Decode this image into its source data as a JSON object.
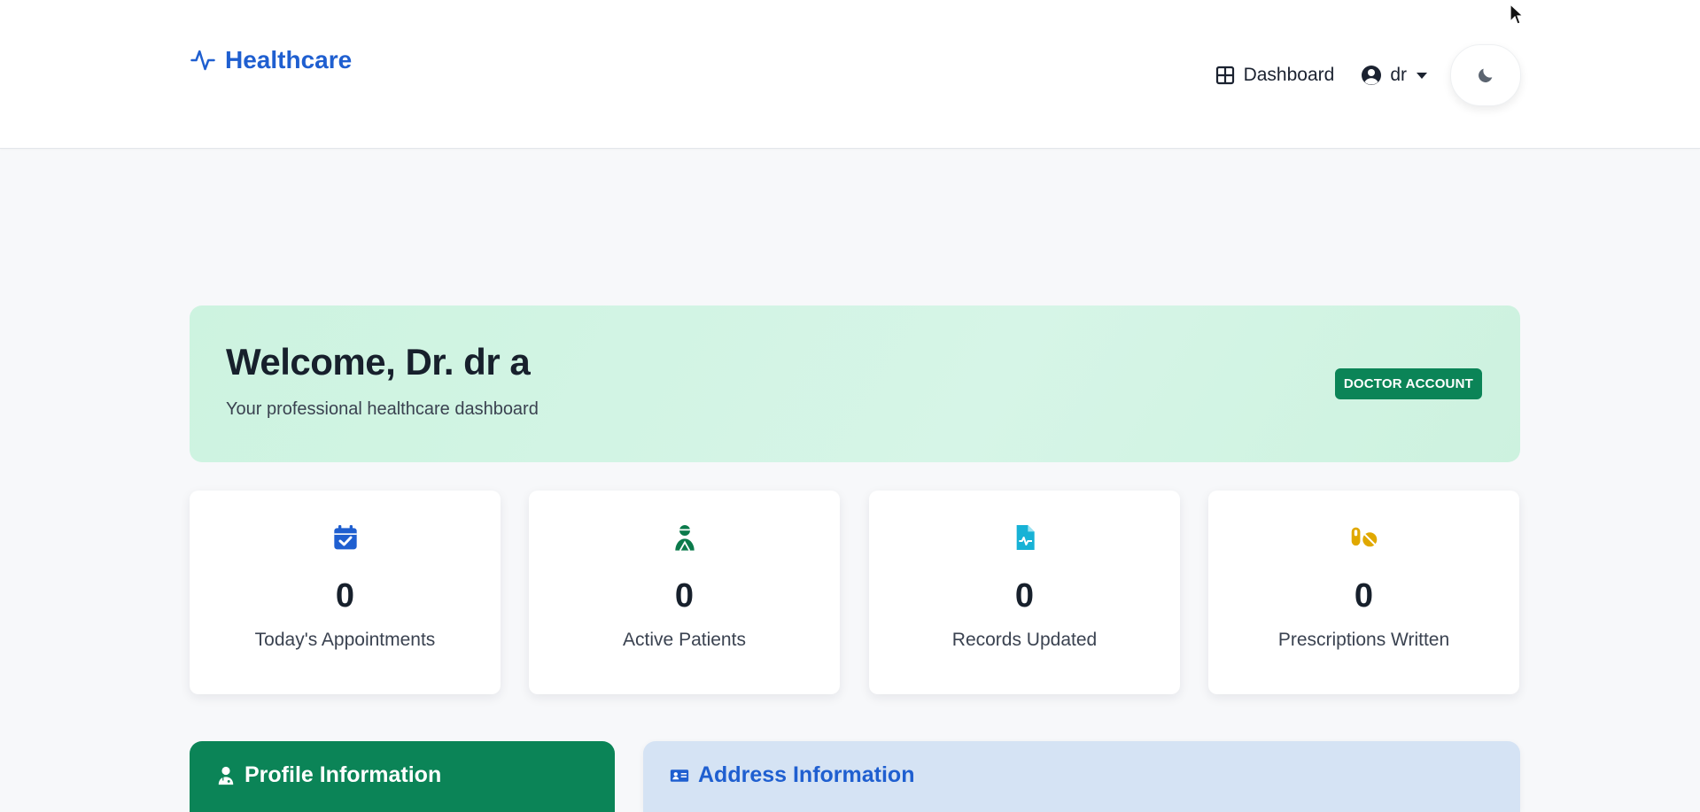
{
  "navbar": {
    "brand": "Healthcare",
    "dashboard_label": "Dashboard",
    "user_label": "dr"
  },
  "welcome": {
    "title": "Welcome, Dr. dr a",
    "subtitle": "Your professional healthcare dashboard",
    "badge": "DOCTOR ACCOUNT"
  },
  "stats": [
    {
      "value": "0",
      "label": "Today's Appointments",
      "icon": "calendar-check-icon",
      "color": "#1f5fd0"
    },
    {
      "value": "0",
      "label": "Active Patients",
      "icon": "user-injured-icon",
      "color": "#0b7a4b"
    },
    {
      "value": "0",
      "label": "Records Updated",
      "icon": "file-medical-icon",
      "color": "#17b2d6"
    },
    {
      "value": "0",
      "label": "Prescriptions Written",
      "icon": "pills-icon",
      "color": "#e0a800"
    }
  ],
  "panels": {
    "profile_title": "Profile Information",
    "address_title": "Address Information"
  },
  "colors": {
    "brand": "#1f5fd0",
    "success": "#0b8457",
    "welcome_bg": "#cdf3e0"
  }
}
